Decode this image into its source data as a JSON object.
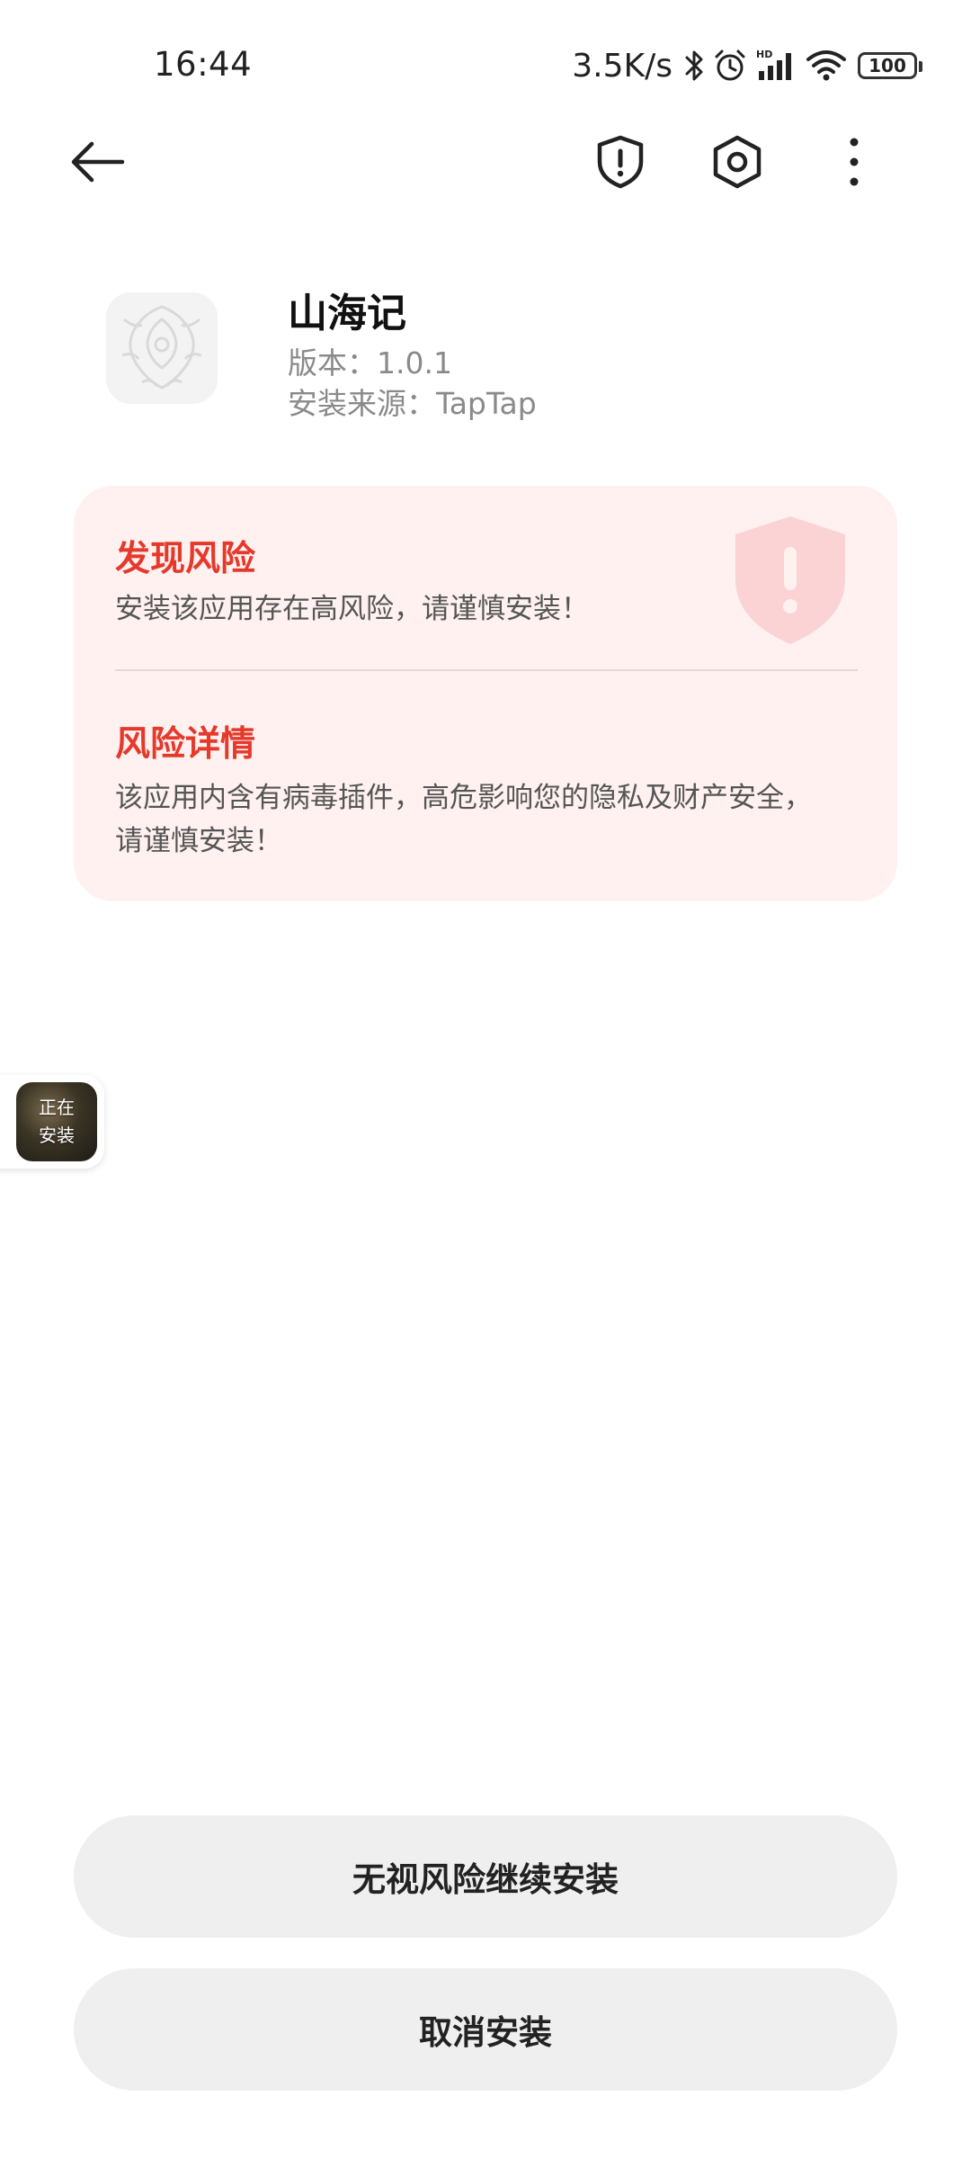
{
  "status_bar": {
    "time": "16:44",
    "net_speed": "3.5K/s",
    "battery_level": "100",
    "icons": [
      "bluetooth-icon",
      "alarm-icon",
      "hd-signal-icon",
      "wifi-icon",
      "battery-icon"
    ]
  },
  "toolbar": {
    "icons": [
      "back-arrow-icon",
      "shield-alert-icon",
      "settings-hexagon-icon",
      "more-vertical-icon"
    ]
  },
  "app": {
    "name": "山海记",
    "version": "版本：1.0.1",
    "source": "安装来源：TapTap"
  },
  "risk": {
    "found_title": "发现风险",
    "found_text": "安装该应用存在高风险，请谨慎安装！",
    "detail_title": "风险详情",
    "detail_line1": "该应用内含有病毒插件，高危影响您的隐私及财产安全，",
    "detail_line2": "请谨慎安装！"
  },
  "install_bubble": {
    "line1": "正在",
    "line2": "安装"
  },
  "buttons": {
    "continue_label": "无视风险继续安装",
    "cancel_label": "取消安装"
  },
  "colors": {
    "risk_red": "#e5392c",
    "risk_card_bg": "#fef1ef",
    "button_bg": "#efefef"
  }
}
